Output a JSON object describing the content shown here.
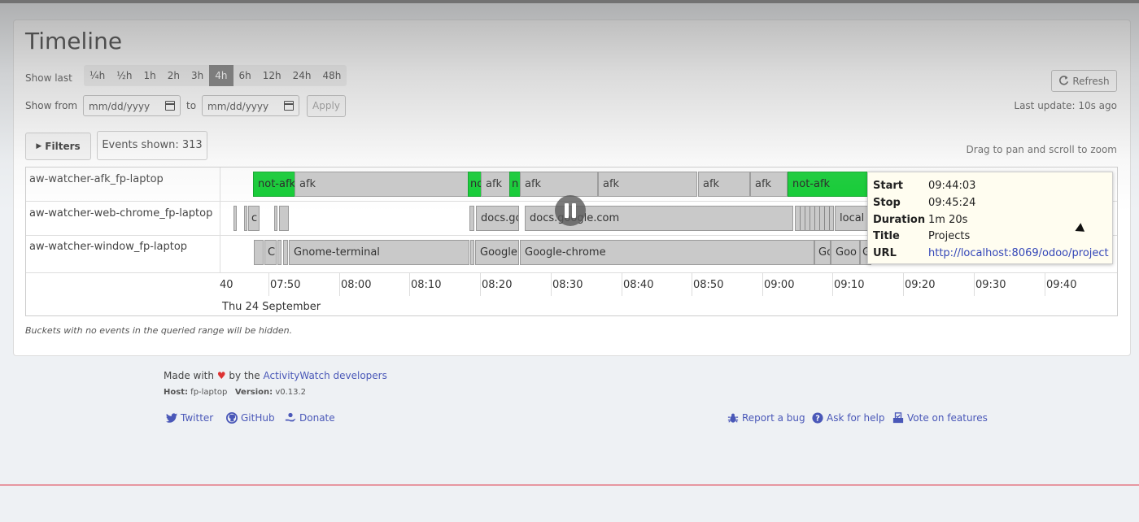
{
  "page": {
    "title": "Timeline"
  },
  "controls": {
    "show_last_label": "Show last",
    "ranges": [
      "¼h",
      "½h",
      "1h",
      "2h",
      "3h",
      "4h",
      "6h",
      "12h",
      "24h",
      "48h"
    ],
    "active_range": "4h",
    "show_from_label": "Show from",
    "from_placeholder": "mm/dd/yyyy",
    "to_label": "to",
    "to_placeholder": "mm/dd/yyyy",
    "apply_label": "Apply",
    "refresh_label": "Refresh",
    "last_update": "Last update: 10s ago",
    "filters_label": "Filters",
    "events_shown": "Events shown: 313",
    "drag_hint": "Drag to pan and scroll to zoom"
  },
  "timeline": {
    "buckets": [
      "aw-watcher-afk_fp-laptop",
      "aw-watcher-web-chrome_fp-laptop",
      "aw-watcher-window_fp-laptop"
    ],
    "afk_segments": [
      "not-afk",
      "afk",
      "no",
      "afk",
      "n",
      "afk",
      "afk",
      "afk",
      "afk",
      "not-afk"
    ],
    "web_segments": [
      "c",
      "docs.gc",
      "docs.google.com",
      "local"
    ],
    "window_segments": [
      "C",
      "Gnome-terminal",
      "Google",
      "Google-chrome",
      "Go",
      "Goo",
      "G"
    ],
    "ticks": [
      "40",
      "07:50",
      "08:00",
      "08:10",
      "08:20",
      "08:30",
      "08:40",
      "08:50",
      "09:00",
      "09:10",
      "09:20",
      "09:30",
      "09:40"
    ],
    "date": "Thu 24 September",
    "footnote": "Buckets with no events in the queried range will be hidden."
  },
  "tooltip": {
    "start_key": "Start",
    "start": "09:44:03",
    "stop_key": "Stop",
    "stop": "09:45:24",
    "duration_key": "Duration",
    "duration": "1m 20s",
    "title_key": "Title",
    "title": "Projects",
    "url_key": "URL",
    "url": "http://localhost:8069/odoo/project"
  },
  "footer": {
    "made_with": "Made with",
    "heart": "♥",
    "by_the": "by the",
    "developers_link": "ActivityWatch developers",
    "host_key": "Host:",
    "host": "fp-laptop",
    "version_key": "Version:",
    "version": "v0.13.2",
    "twitter": "Twitter",
    "github": "GitHub",
    "donate": "Donate",
    "report_bug": "Report a bug",
    "ask_help": "Ask for help",
    "vote": "Vote on features"
  },
  "colors": {
    "afk_active": "#11cc33",
    "inactive": "#c9c9c9",
    "link": "#4a58b8"
  }
}
